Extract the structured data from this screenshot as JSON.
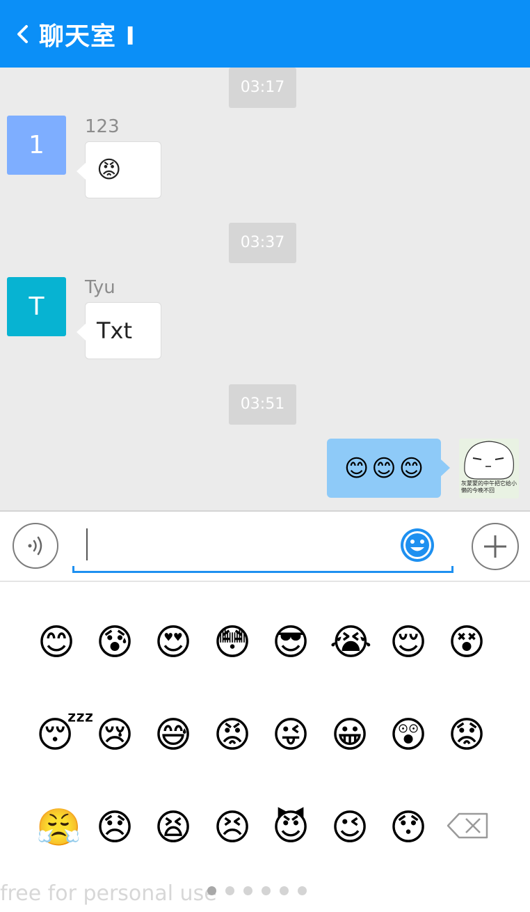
{
  "header": {
    "title": "聊天室 I"
  },
  "messages": [
    {
      "time": "03:17",
      "avatar_letter": "1",
      "avatar_color": "#7eaeff",
      "sender": "123",
      "content_emoji": "😡"
    },
    {
      "time": "03:37",
      "avatar_letter": "T",
      "avatar_color": "#07b3d2",
      "sender": "Tyu",
      "content_text": "Txt"
    },
    {
      "time": "03:51",
      "outgoing": true,
      "content_emoji": [
        "😊",
        "😊",
        "😊"
      ]
    }
  ],
  "sticker_text": "灰蒙蒙的中午把它给小懒的今晚不回",
  "emoji_grid": [
    [
      "😊",
      "😰",
      "😍",
      "😳",
      "😎",
      "😭",
      "😌",
      "😵"
    ],
    [
      "😴",
      "😢",
      "😅",
      "😡",
      "😜",
      "😀",
      "😲",
      "😟"
    ],
    [
      "😤",
      "😞",
      "😫",
      "😣",
      "😈",
      "😉",
      "😯"
    ]
  ],
  "pager": {
    "pages": 6,
    "current": 1
  },
  "watermark": "free for personal use",
  "colors": {
    "header": "#0b8ff7",
    "outgoing_bubble": "#8ecaf8",
    "accent": "#1e90f0"
  }
}
